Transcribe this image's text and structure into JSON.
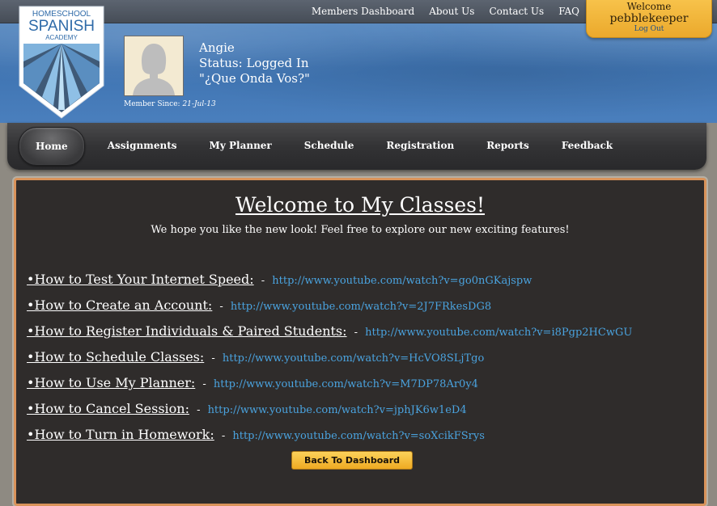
{
  "top_nav": {
    "items": [
      "Members Dashboard",
      "About Us",
      "Contact Us",
      "FAQ"
    ]
  },
  "welcome_box": {
    "greeting": "Welcome",
    "username": "pebblekeeper",
    "logout": "Log Out"
  },
  "logo": {
    "line1": "HOMESCHOOL",
    "line2": "SPANISH",
    "line3": "ACADEMY"
  },
  "user": {
    "name": "Angie",
    "status": "Status: Logged In",
    "motto": "\"¿Que Onda Vos?\"",
    "member_since_label": "Member Since:",
    "member_since_date": "21-Jul-13"
  },
  "main_nav": {
    "items": [
      "Home",
      "Assignments",
      "My Planner",
      "Schedule",
      "Registration",
      "Reports",
      "Feedback"
    ],
    "active": "Home"
  },
  "content": {
    "title": "Welcome to My Classes!",
    "subtitle": "We hope you like the new look! Feel free to explore our new exciting features!",
    "separator": "-",
    "links": [
      {
        "title": "•How to Test Your Internet Speed:",
        "url": "http://www.youtube.com/watch?v=go0nGKajspw"
      },
      {
        "title": "•How to Create an Account:",
        "url": "http://www.youtube.com/watch?v=2J7FRkesDG8"
      },
      {
        "title": "•How to Register Individuals & Paired Students:",
        "url": "http://www.youtube.com/watch?v=i8Pgp2HCwGU"
      },
      {
        "title": "•How to Schedule Classes:",
        "url": "http://www.youtube.com/watch?v=HcVO8SLjTgo"
      },
      {
        "title": "•How to Use My Planner:",
        "url": "http://www.youtube.com/watch?v=M7DP78Ar0y4"
      },
      {
        "title": "•How to Cancel Session:",
        "url": "http://www.youtube.com/watch?v=jphJK6w1eD4"
      },
      {
        "title": "•How to Turn in Homework:",
        "url": "http://www.youtube.com/watch?v=soXcikFSrys"
      }
    ],
    "back_button": "Back To Dashboard"
  },
  "colors": {
    "header_blue": "#4a7fbd",
    "accent_orange": "#eba92c",
    "link_blue": "#4aa3df",
    "content_bg": "#2f2c2b"
  }
}
